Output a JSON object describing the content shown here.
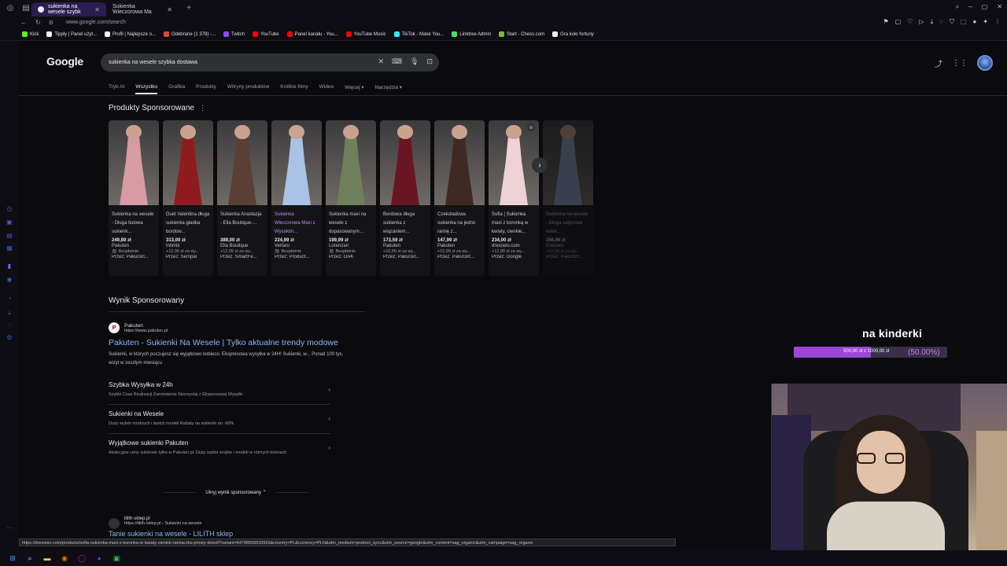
{
  "browser": {
    "tabs": [
      {
        "label": "sukienka na wesele szybk",
        "active": true
      },
      {
        "label": "Sukienka Wieczorowa Ma",
        "active": false
      }
    ],
    "url": "www.google.com/search",
    "bookmarks": [
      {
        "label": "Kick",
        "color": "#53fc18"
      },
      {
        "label": "Tipply | Panel użyt...",
        "color": "#f1f1f1"
      },
      {
        "label": "Profil | Najlepsze o...",
        "color": "#f1f1f1"
      },
      {
        "label": "Odebrane (1 378) -...",
        "color": "#ea4335"
      },
      {
        "label": "Twitch",
        "color": "#9146ff"
      },
      {
        "label": "YouTube",
        "color": "#ff0000"
      },
      {
        "label": "Panel kanału - You...",
        "color": "#ff0000"
      },
      {
        "label": "YouTube Music",
        "color": "#ff0000"
      },
      {
        "label": "TikTok - Make You...",
        "color": "#25f4ee"
      },
      {
        "label": "Linktree Admin",
        "color": "#43e660"
      },
      {
        "label": "Start - Chess.com",
        "color": "#81b64c"
      },
      {
        "label": "Gra koło fortuny",
        "color": "#f1f1f1"
      }
    ],
    "status_url": "https://dresowo.com/products/sofia-sukienka-maxi-z-koronka-w-kwiaty-cienkie-ramiaczka-prosty-dekolt?variant=64798556533565&country=PL&currency=PLN&utm_medium=product_sync&utm_source=google&utm_content=sag_organic&utm_campaign=sag_organic"
  },
  "google": {
    "logo": "Google",
    "query": "sukienka na wesele szybka dostawa",
    "nav_tabs": [
      "Tryb AI",
      "Wszystko",
      "Grafika",
      "Produkty",
      "Witryny produktów",
      "Krótkie filmy",
      "Wideo",
      "Więcej ▾",
      "Narzędzia ▾"
    ],
    "active_tab": "Wszystko",
    "sponsored_products_title": "Produkty Sponsorowane",
    "products": [
      {
        "name": "Sukienka na wesele - Długa tiulowa sukienk...",
        "price": "249,89 zł",
        "shop": "Pakuten",
        "shipping": "🛍 Bezpłatnie",
        "by": "Przez: PakuGirl...",
        "color": "#d89aa3",
        "visited": false
      },
      {
        "name": "Duet Valentina długa sukienka gładka bordow...",
        "price": "313,00 zł",
        "shop": "Intimiti",
        "shipping": "+12,90 zł za wy...",
        "by": "Przez: Sempai",
        "color": "#8e1c1f",
        "visited": false
      },
      {
        "name": "Sukienka Anastazja - Ella Boutique-...",
        "price": "389,00 zł",
        "shop": "Ella Boutique",
        "shipping": "+12,99 zł za wy...",
        "by": "Przez: SmartFe...",
        "color": "#5b3f36",
        "visited": false
      },
      {
        "name": "Sukienka Wieczorowa Maxi z Wysokim...",
        "price": "224,99 zł",
        "shop": "Verlaro",
        "shipping": "🛍 Bezpłatnie",
        "by": "Przez: Product...",
        "color": "#a9c3e6",
        "visited": true
      },
      {
        "name": "Sukienka maxi na wesele z dopasowanym...",
        "price": "199,99 zł",
        "shop": "Lorenzari",
        "shipping": "🛍 Bezpłatnie",
        "by": "Przez: OAK",
        "color": "#6f7f5c",
        "visited": false
      },
      {
        "name": "Bordowa długa sukienka z wiązaniem...",
        "price": "173,59 zł",
        "shop": "Pakuten",
        "shipping": "+10,99 zł za wy...",
        "by": "Przez: PakuGirl...",
        "color": "#6a1524",
        "visited": false
      },
      {
        "name": "Czekoladowa sukienka na jedno ramię z...",
        "price": "147,99 zł",
        "shop": "Pakuten",
        "shipping": "+10,99 zł za wy...",
        "by": "Przez: PakuGirl...",
        "color": "#3e2a22",
        "visited": false
      },
      {
        "name": "Sofia | Sukienka maxi z koronką w kwiaty, cienkie...",
        "price": "234,00 zł",
        "shop": "dresowo.com",
        "shipping": "+12,99 zł za wy...",
        "by": "Przez: Google",
        "color": "#eed2d6",
        "visited": false
      },
      {
        "name": "Sukienka na wesele - Długa satynowa sukie...",
        "price": "156,99 zł",
        "shop": "Pakuten",
        "shipping": "+10,99 zł za wy...",
        "by": "Przez: PakuGirl...",
        "color": "#8fa2c4",
        "visited": false
      }
    ],
    "sponsored_result_title": "Wynik Sponsorowany",
    "ad": {
      "favicon_letter": "P",
      "site_name": "Pakuten",
      "site_url": "https://www.pakuten.pl",
      "title": "Pakuten - Sukienki Na Wesele | Tylko aktualne trendy modowe",
      "description": "Sukienki, w których poczujesz się wyjątkowo kobieco. Ekspresowa wysyłka w 24H! Sukienki, w... Ponad 100 tys. wizyt w zeszłym miesiącu"
    },
    "sitelinks": [
      {
        "title": "Szybka Wysyłka w 24h",
        "desc": "Szybki Czas Realizacji Zamówienia Skorzystaj z Ekspresowej Wysyłki"
      },
      {
        "title": "Sukienki na Wesele",
        "desc": "Duży wybór modnych i tanich modeli Rabaty na sukienki do -90%"
      },
      {
        "title": "Wyjątkowe sukienki Pakuten",
        "desc": "Atrakcyjne ceny sukienek tylko w Pakuten.pl. Duży wybór krojów i modeli w różnych kolorach"
      }
    ],
    "hide_sponsored": "Ukryj wynik sponsorowany ⌃",
    "next_result": {
      "site_name": "lilith-sklep.pl",
      "site_url": "https://lilith-sklep.pl › Sukienki na wesele",
      "title": "Tanie sukienki na wesele - LILITH sklep"
    }
  },
  "overlay": {
    "goal_title": "na kinderki",
    "goal_amount": "500,00 zł z 1000,00 zł",
    "goal_percent_text": "(50.00%)",
    "goal_fraction": 0.5
  }
}
